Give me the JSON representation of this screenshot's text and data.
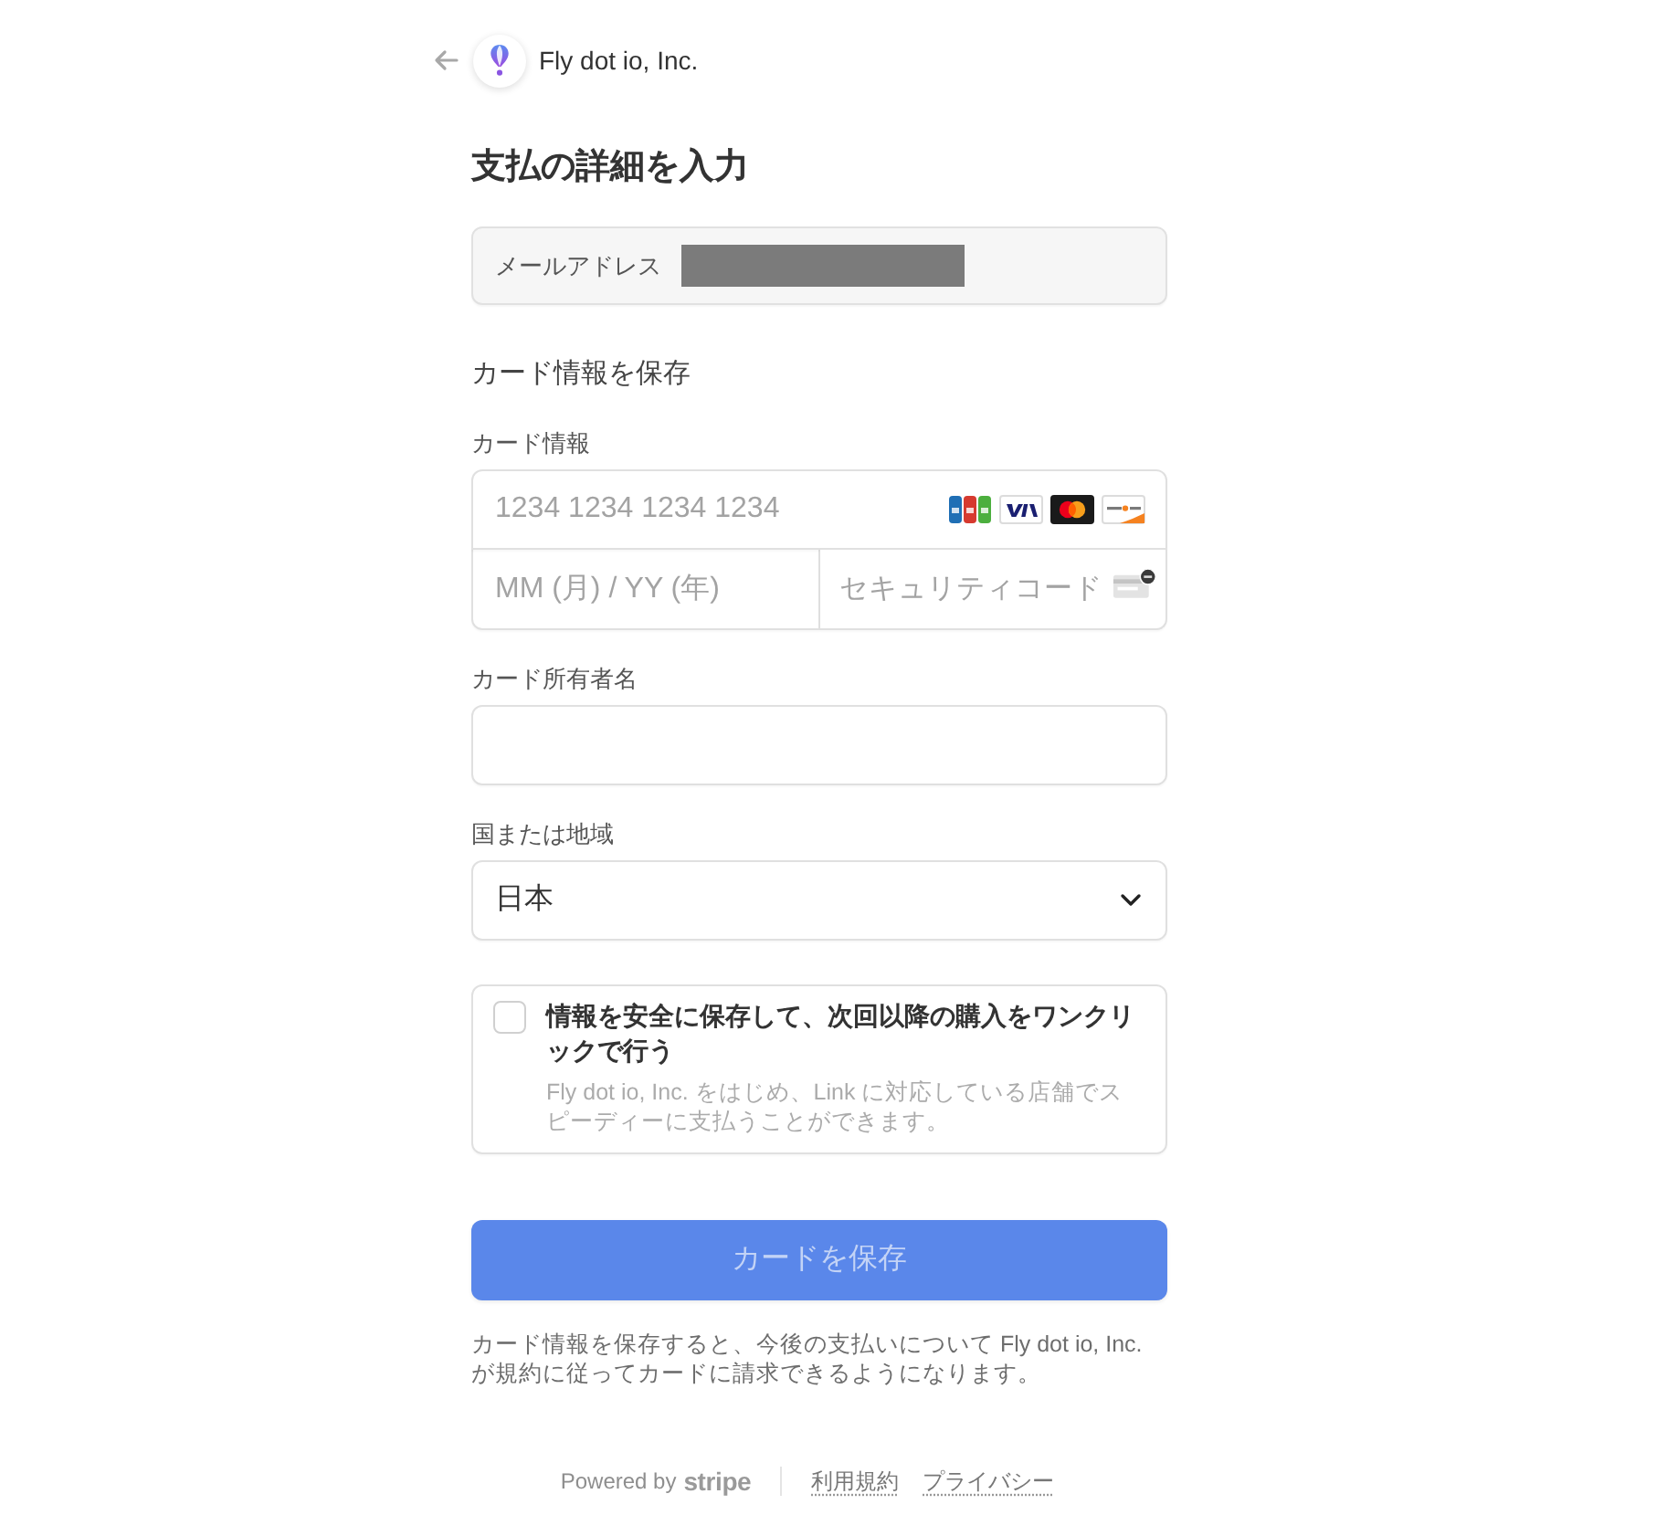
{
  "header": {
    "merchant": "Fly dot io, Inc."
  },
  "title": "支払の詳細を入力",
  "email": {
    "label": "メールアドレス",
    "redacted": true
  },
  "section_title": "カード情報を保存",
  "card": {
    "label": "カード情報",
    "number_placeholder": "1234 1234 1234 1234",
    "expiry_placeholder": "MM (月) / YY (年)",
    "cvc_placeholder": "セキュリティコード"
  },
  "cardholder": {
    "label": "カード所有者名"
  },
  "country": {
    "label": "国または地域",
    "value": "日本"
  },
  "save_option": {
    "checked": false,
    "title": "情報を安全に保存して、次回以降の購入をワンクリックで行う",
    "description": "Fly dot io, Inc. をはじめ、Link に対応している店舗でスピーディーに支払うことができます。"
  },
  "submit": {
    "label": "カードを保存",
    "disabled": true
  },
  "note": "カード情報を保存すると、今後の支払いについて Fly dot io, Inc. が規約に従ってカードに請求できるようになります。",
  "footer": {
    "powered_by": "Powered by",
    "brand": "stripe",
    "links": [
      "利用規約",
      "プライバシー"
    ]
  }
}
